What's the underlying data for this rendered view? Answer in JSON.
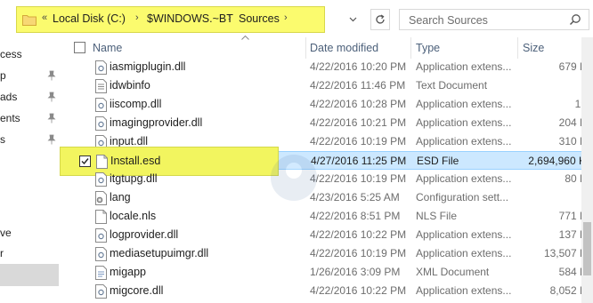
{
  "address_bar": {
    "overflow": "«",
    "crumbs": [
      "Local Disk (C:)",
      "$WINDOWS.~BT",
      "Sources"
    ],
    "highlight_color": "#fbfb6e"
  },
  "search": {
    "placeholder": "Search Sources"
  },
  "nav": {
    "items": [
      {
        "label": "cess",
        "pinned": false
      },
      {
        "label": "p",
        "pinned": true
      },
      {
        "label": "ads",
        "pinned": true
      },
      {
        "label": "ents",
        "pinned": true
      },
      {
        "label": "s",
        "pinned": true
      },
      {
        "label": "ve",
        "pinned": false
      },
      {
        "label": "r",
        "pinned": false
      }
    ]
  },
  "columns": {
    "name": "Name",
    "date_modified": "Date modified",
    "type": "Type",
    "size": "Size"
  },
  "files": [
    {
      "name": "iasmigplugin.dll",
      "date": "4/22/2016 10:20 PM",
      "type": "Application extens...",
      "size": "679 K",
      "icon": "dll-file-icon"
    },
    {
      "name": "idwbinfo",
      "date": "4/22/2016 11:46 PM",
      "type": "Text Document",
      "size": "1",
      "icon": "text-file-icon"
    },
    {
      "name": "iiscomp.dll",
      "date": "4/22/2016 10:28 PM",
      "type": "Application extens...",
      "size": "19",
      "icon": "dll-file-icon"
    },
    {
      "name": "imagingprovider.dll",
      "date": "4/22/2016 10:21 PM",
      "type": "Application extens...",
      "size": "204 K",
      "icon": "dll-file-icon"
    },
    {
      "name": "input.dll",
      "date": "4/22/2016 10:19 PM",
      "type": "Application extens...",
      "size": "310 K",
      "icon": "dll-file-icon"
    },
    {
      "name": "Install.esd",
      "date": "4/27/2016 11:25 PM",
      "type": "ESD File",
      "size": "2,694,960 K",
      "icon": "esd-file-icon",
      "selected": true
    },
    {
      "name": "itgtupg.dll",
      "date": "4/22/2016 10:19 PM",
      "type": "Application extens...",
      "size": "80 K",
      "icon": "dll-file-icon"
    },
    {
      "name": "lang",
      "date": "4/23/2016 5:25 AM",
      "type": "Configuration sett...",
      "size": "1",
      "icon": "config-file-icon"
    },
    {
      "name": "locale.nls",
      "date": "4/22/2016 8:51 PM",
      "type": "NLS File",
      "size": "771 K",
      "icon": "nls-file-icon"
    },
    {
      "name": "logprovider.dll",
      "date": "4/22/2016 10:22 PM",
      "type": "Application extens...",
      "size": "137 K",
      "icon": "dll-file-icon"
    },
    {
      "name": "mediasetupuimgr.dll",
      "date": "4/22/2016 10:19 PM",
      "type": "Application extens...",
      "size": "13,507 K",
      "icon": "dll-file-icon"
    },
    {
      "name": "migapp",
      "date": "1/26/2016 3:09 PM",
      "type": "XML Document",
      "size": "584 K",
      "icon": "xml-file-icon"
    },
    {
      "name": "migcore.dll",
      "date": "4/22/2016 10:22 PM",
      "type": "Application extens...",
      "size": "8,052 K",
      "icon": "dll-file-icon"
    }
  ],
  "colors": {
    "selection_bg": "#cce8ff",
    "selection_border": "#99d1ff",
    "highlight": "#f2f55f",
    "header_text": "#4c607a"
  }
}
